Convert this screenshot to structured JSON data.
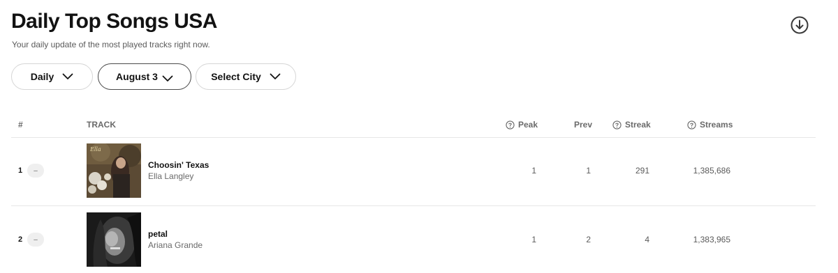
{
  "header": {
    "title": "Daily Top Songs USA",
    "subtitle": "Your daily update of the most played tracks right now.",
    "download_icon": "download-circle-icon"
  },
  "filters": {
    "period": "Daily",
    "date": "August 3",
    "city": "Select City"
  },
  "table": {
    "columns": {
      "rank": "#",
      "track": "TRACK",
      "peak": "Peak",
      "prev": "Prev",
      "streak": "Streak",
      "streams": "Streams"
    },
    "rows": [
      {
        "rank": "1",
        "movement": "–",
        "title": "Choosin' Texas",
        "artist": "Ella Langley",
        "peak": "1",
        "prev": "1",
        "streak": "291",
        "streams": "1,385,686"
      },
      {
        "rank": "2",
        "movement": "–",
        "title": "petal",
        "artist": "Ariana Grande",
        "peak": "1",
        "prev": "2",
        "streak": "4",
        "streams": "1,383,965"
      }
    ]
  }
}
